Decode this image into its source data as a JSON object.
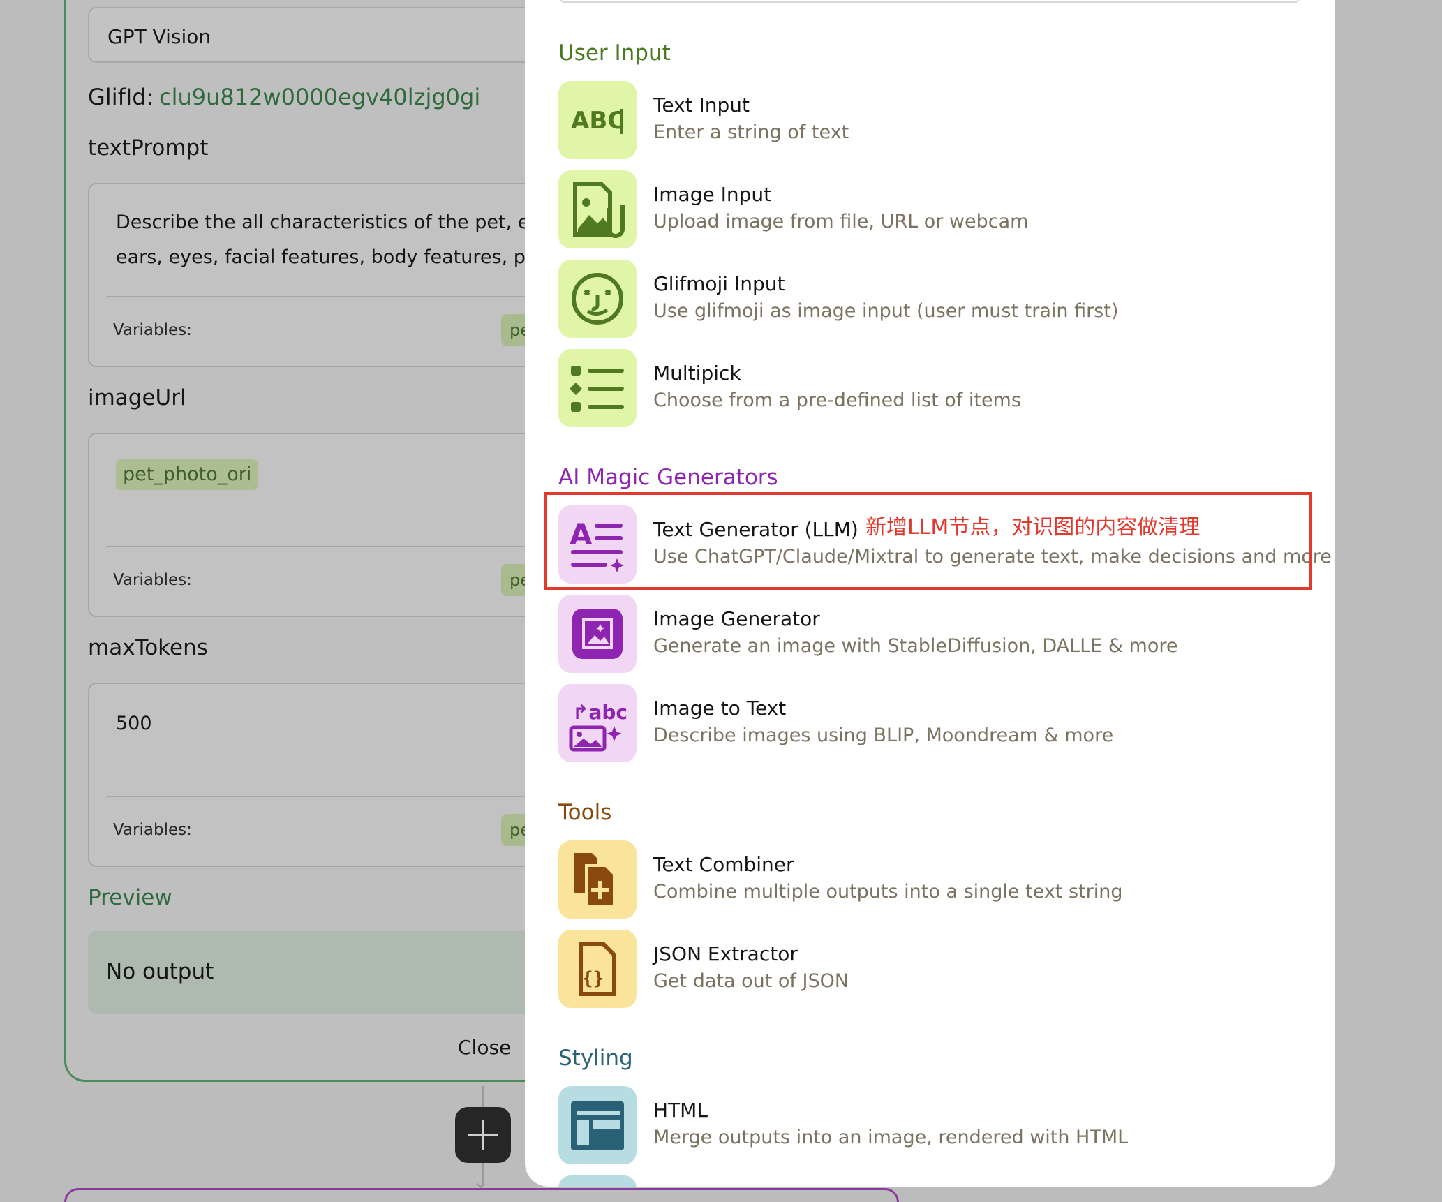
{
  "editor": {
    "node_title": "GPT Vision",
    "glif_label": "GlifId:",
    "glif_value": "clu9u812w0000egv40lzjg0gi",
    "fields": [
      {
        "name": "textPrompt",
        "value_line1": "Describe the all characteristics of the pet, e.g",
        "value_line2": "ears,  eyes, facial features, body features, pos",
        "variables_label": "Variables:",
        "chip": "pe"
      },
      {
        "name": "imageUrl",
        "chip_value": "pet_photo_ori",
        "variables_label": "Variables:",
        "chip": "pe"
      },
      {
        "name": "maxTokens",
        "value": "500",
        "variables_label": "Variables:",
        "chip": "pe"
      }
    ],
    "preview_label": "Preview",
    "preview_value": "No output",
    "close_label": "Close"
  },
  "menu": {
    "sections": [
      {
        "title": "User Input",
        "color": "#4a7a1e",
        "items": [
          {
            "title": "Text Input",
            "desc": "Enter a string of text",
            "icon": "abc-cursor-icon"
          },
          {
            "title": "Image Input",
            "desc": "Upload image from file, URL or webcam",
            "icon": "image-attachment-icon"
          },
          {
            "title": "Glifmoji Input",
            "desc": "Use glifmoji as image input (user must train first)",
            "icon": "smiley-face-icon"
          },
          {
            "title": "Multipick",
            "desc": "Choose from a pre-defined list of items",
            "icon": "list-icon"
          }
        ]
      },
      {
        "title": "AI Magic Generators",
        "color": "#8e25b0",
        "items": [
          {
            "title": "Text Generator (LLM)",
            "desc": "Use ChatGPT/Claude/Mixtral to generate text, make decisions and more",
            "icon": "text-generator-icon"
          },
          {
            "title": "Image Generator",
            "desc": "Generate an image with StableDiffusion, DALLE & more",
            "icon": "image-frame-icon"
          },
          {
            "title": "Image to Text",
            "desc": "Describe images using BLIP, Moondream & more",
            "icon": "image-to-text-icon"
          }
        ]
      },
      {
        "title": "Tools",
        "color": "#8a4a0e",
        "items": [
          {
            "title": "Text Combiner",
            "desc": "Combine multiple outputs into a single text string",
            "icon": "copy-plus-icon"
          },
          {
            "title": "JSON Extractor",
            "desc": "Get data out of JSON",
            "icon": "json-file-icon"
          }
        ]
      },
      {
        "title": "Styling",
        "color": "#2b6176",
        "items": [
          {
            "title": "HTML",
            "desc": "Merge outputs into an image, rendered with HTML",
            "icon": "layout-icon"
          }
        ]
      }
    ]
  },
  "annotation": {
    "text": "新增LLM节点，对识图的内容做清理",
    "color": "#e03a2f"
  },
  "colors": {
    "green_tile": "#e0f5a8",
    "purple_tile": "#f2d7f5",
    "yellow_tile": "#fae39a",
    "teal_tile": "#b7dde3"
  }
}
